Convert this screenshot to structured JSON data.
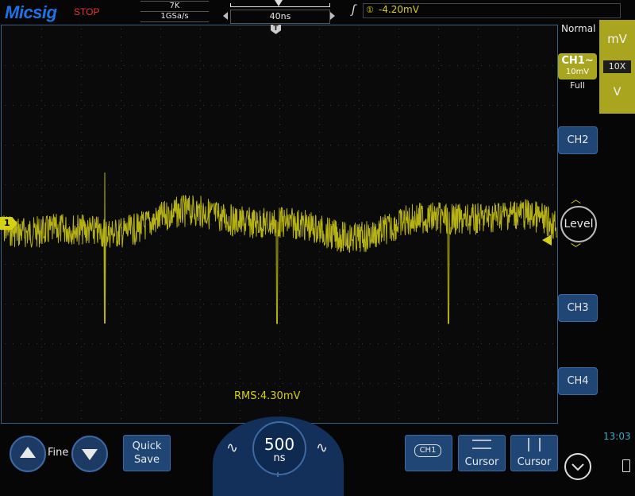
{
  "brand": {
    "logo": "Micsig",
    "run_state": "STOP"
  },
  "acquisition": {
    "memory_depth": "7K",
    "sample_rate": "1GSa/s"
  },
  "timebase_top": {
    "value": "40ns"
  },
  "trigger": {
    "source": "①",
    "level": "-4.20mV"
  },
  "trigger_mode": "Normal",
  "unit_panel": {
    "mv": "mV",
    "probe": "10X",
    "v": "V"
  },
  "channels": {
    "ch1": {
      "label": "CH1",
      "coupling_symbol": "~",
      "scale": "10mV",
      "bandwidth": "Full"
    },
    "ch2": {
      "label": "CH2"
    },
    "ch3": {
      "label": "CH3"
    },
    "ch4": {
      "label": "CH4"
    }
  },
  "level_control": {
    "label": "Level",
    "up": "︿",
    "down": "﹀"
  },
  "measurement": {
    "rms": "RMS:4.30mV"
  },
  "ch1_marker": "1",
  "trig_pos_marker": "T",
  "bottom": {
    "fine_label": "Fine",
    "quick_save": [
      "Quick",
      "Save"
    ],
    "timebase_dial": {
      "value": "500",
      "unit": "ns"
    },
    "ch_select": "CH1",
    "cursor_h": "Cursor",
    "cursor_v": "Cursor"
  },
  "clock": "13:03",
  "colors": {
    "ch1": "#d6d016",
    "accent_blue": "#1f4675",
    "grid": "#3a3a3a"
  }
}
